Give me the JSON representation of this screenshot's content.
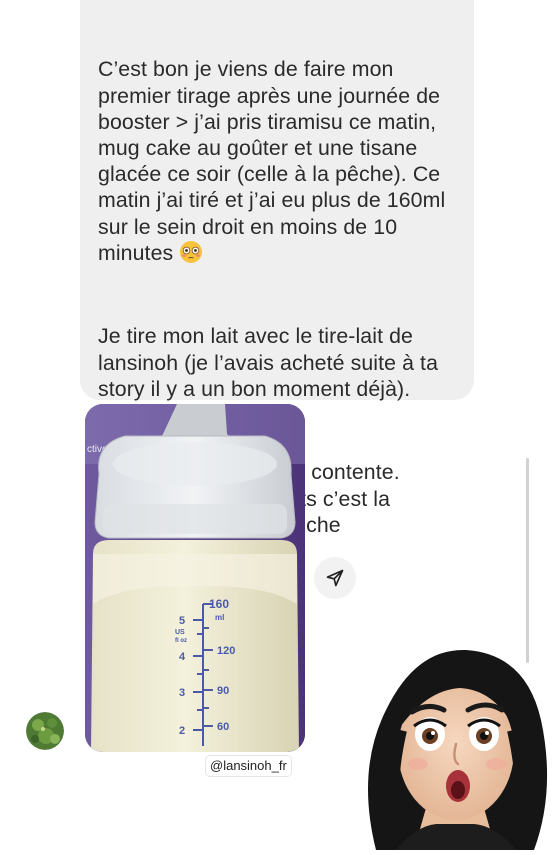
{
  "message": {
    "paragraph_1": "C’est bon je viens de faire mon premier tirage après une journée de booster > j’ai pris tiramisu ce matin, mug cake au goûter et une tisane glacée ce soir (celle à la pêche). Ce matin j’ai tiré et j’ai eu plus de 160ml sur le sein droit en moins de 10 minutes ",
    "emoji": "flushed-face",
    "paragraph_2": "Je tire mon lait avec le tire-lait de lansinoh (je l’avais acheté suite à ta story il y a un bon moment déjà).",
    "paragraph_3": "Voilà voilà je suis trop contente. Merci pour tes produits c’est la révolution. Bon dimanche"
  },
  "photo": {
    "background_label": "ctive",
    "bottle_marks": {
      "ml_label": "160",
      "ml_unit": "ml",
      "oz_label_1": "US",
      "oz_label_2": "fl oz",
      "ml_ticks": [
        "120",
        "90",
        "60"
      ],
      "oz_ticks": [
        "5",
        "4",
        "3",
        "2"
      ]
    }
  },
  "mention": "@lansinoh_fr",
  "icons": {
    "share": "send-icon",
    "avatar": "profile-avatar",
    "sticker": "memoji-surprised-sticker"
  },
  "colors": {
    "bubble": "#efefef",
    "text": "#2a2a2a",
    "photo_background": "#5a3f8a",
    "bottle_marks": "#4a5aa8"
  }
}
